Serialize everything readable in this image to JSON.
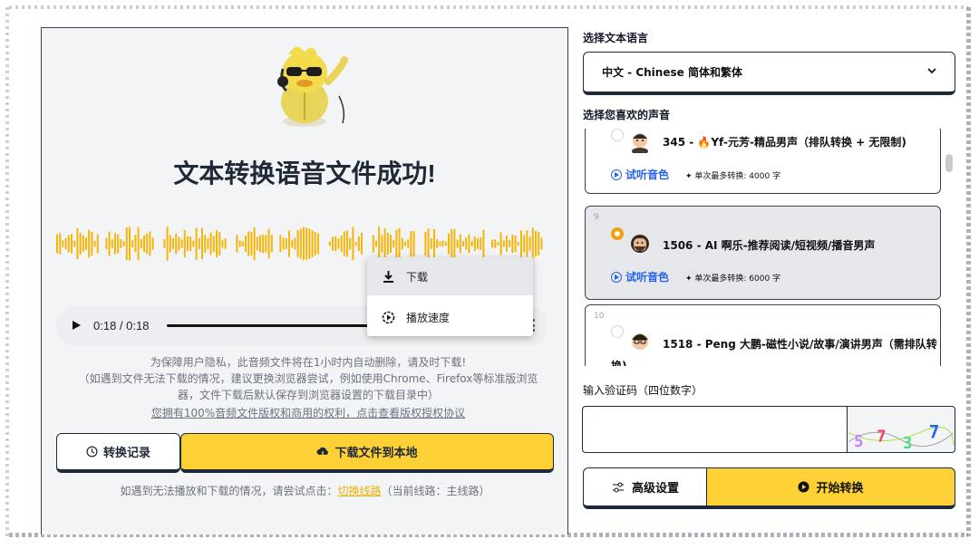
{
  "result": {
    "title": "文本转换语音文件成功!",
    "player": {
      "time": "0:18 / 0:18",
      "progress": 1.0
    },
    "menu": {
      "download": "下载",
      "speed": "播放速度"
    },
    "notices": [
      "为保障用户隐私，此音频文件将在1小时内自动删除，请及时下载!",
      "（如遇到文件无法下载的情况，建议更换浏览器尝试，例如使用Chrome、Firefox等标准版浏览",
      "器，文件下载后默认保存到浏览器设置的下载目录中）"
    ],
    "license_link": "您拥有100%音频文件版权和商用的权利，点击查看版权授权协议",
    "history_button": "转换记录",
    "download_button": "下载文件到本地",
    "hint_prefix": "如遇到无法播放和下载的情况，请尝试点击：",
    "hint_link": "切换线路",
    "hint_suffix": "（当前线路：主线路）"
  },
  "language": {
    "label": "选择文本语言",
    "selected": "中文 - Chinese 简体和繁体"
  },
  "voices": {
    "label": "选择您喜欢的声音",
    "items": [
      {
        "index": "",
        "name": "345 - 🔥Yf-元芳-精品男声（排队转换 + 无限制)",
        "listen": "试听音色",
        "limit": "单次最多转换: 4000 字",
        "selected": false
      },
      {
        "index": "9",
        "name": "1506 - AI 啊乐-推荐阅读/短视频/播音男声",
        "listen": "试听音色",
        "limit": "单次最多转换: 6000 字",
        "selected": true
      },
      {
        "index": "10",
        "name": "1518 - Peng 大鹏-磁性小说/故事/演讲男声（需排队转",
        "name_wrap": "换)",
        "selected": false
      }
    ]
  },
  "captcha": {
    "label": "输入验证码（四位数字）",
    "value": "",
    "image_text": "5737"
  },
  "actions": {
    "advanced": "高级设置",
    "start": "开始转换"
  },
  "colors": {
    "accent": "#fdd035",
    "link": "#2563eb",
    "wave": "#f5b50a"
  }
}
